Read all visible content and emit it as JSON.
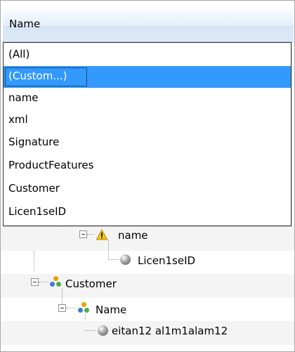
{
  "column_header": {
    "label": "Name"
  },
  "dropdown": {
    "selected_index": 1,
    "items": [
      {
        "label": "(All)"
      },
      {
        "label": "(Custom...)"
      },
      {
        "label": "name"
      },
      {
        "label": "xml"
      },
      {
        "label": "Signature"
      },
      {
        "label": "ProductFeatures"
      },
      {
        "label": "Customer"
      },
      {
        "label": "Licen1seID"
      }
    ]
  },
  "tree": {
    "rows": [
      {
        "label": "name",
        "icon": "warning-icon"
      },
      {
        "label": "Licen1seID",
        "icon": "sphere-icon"
      },
      {
        "label": "Customer",
        "icon": "group-icon"
      },
      {
        "label": "Name",
        "icon": "group-icon"
      },
      {
        "label": "eitan12 al1m1alam12",
        "icon": "sphere-icon"
      }
    ]
  },
  "colors": {
    "selection": "#3399ff",
    "header_gradient_top": "#f8fbff",
    "header_gradient_bottom": "#dbe8f7",
    "alt_row": "#f4f4f4"
  }
}
